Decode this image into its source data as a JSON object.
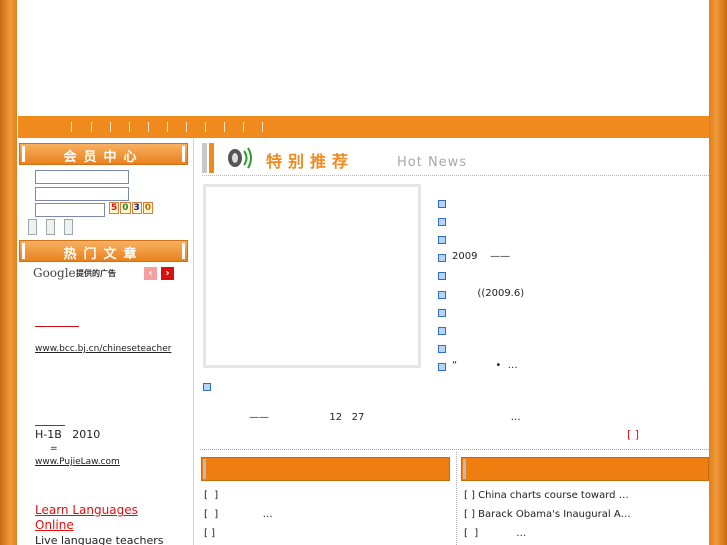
{
  "member_box": {
    "title": "会员中心",
    "captcha_digits": [
      "5",
      "0",
      "3",
      "0"
    ]
  },
  "hot_box": {
    "title": "热门文章"
  },
  "google_ad": {
    "logo": "Google",
    "sub": "提供的广告",
    "ad1_url": "www.bcc.bj.cn/chineseteacher",
    "ad2_line": "H-1B   2010",
    "ad2_eq": "=",
    "ad2_url": "www.PujieLaw.com",
    "ad3_link": "Learn Languages Online",
    "ad3_desc": "Live language teachers"
  },
  "featured": {
    "title": "特别推荐",
    "title_en": "Hot News",
    "items": [
      "",
      "",
      "",
      "2009    ——",
      "",
      "        ((2009.6)",
      "",
      "",
      "",
      "“            •  …"
    ],
    "extra_text": "——                   12   27                                              …",
    "more": "[  ]"
  },
  "list_left": [
    "[  ]",
    "[  ]              …",
    "[ ]"
  ],
  "list_right": [
    "[  ] China charts course toward …",
    "[  ] Barack Obama's Inaugural A…",
    "[  ]            …"
  ],
  "colors": {
    "orange": "#f08a1c",
    "red": "#e01010",
    "blue": "#2f6ebd"
  }
}
